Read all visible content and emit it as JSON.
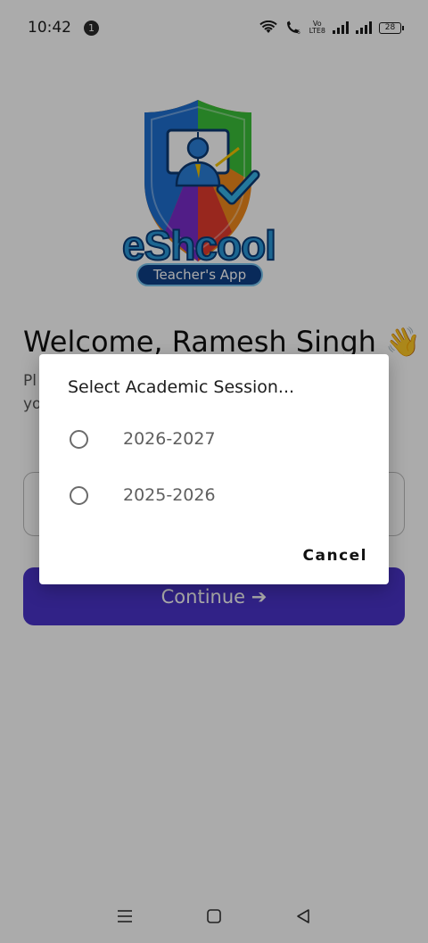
{
  "status_bar": {
    "time": "10:42",
    "notification_count": "1",
    "volte_label_top": "Vo",
    "volte_label_bottom": "LTE8",
    "battery_level": "28"
  },
  "branding": {
    "app_name": "eShcool",
    "tagline": "Teacher's App",
    "colors": {
      "blue": "#2a98d8",
      "dark_blue": "#0e3f86",
      "green": "#3bbf3a",
      "orange": "#f08a1c"
    }
  },
  "main": {
    "welcome_text": "Welcome, Ramesh Singh 👋",
    "subtitle_text": "Pl                                                          o\nyo",
    "continue_label": "Continue ➔",
    "accent_color": "#4a34c9"
  },
  "dialog": {
    "title": "Select Academic Session...",
    "options": [
      {
        "label": "2026-2027",
        "selected": false
      },
      {
        "label": "2025-2026",
        "selected": false
      }
    ],
    "cancel_label": "Cancel"
  },
  "nav_bar": {
    "icons": [
      "menu-icon",
      "home-square-icon",
      "back-triangle-icon"
    ]
  }
}
